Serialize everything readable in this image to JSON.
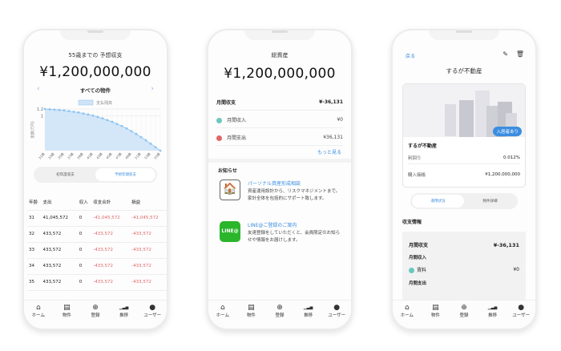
{
  "screen1": {
    "title": "55歳までの 予想収支",
    "amount": "¥1,200,000,000",
    "property": "すべての物件",
    "toggle": [
      "初年度収支",
      "予想年間収支"
    ],
    "table": {
      "headers": [
        "年齢",
        "支出",
        "収入",
        "収支合計",
        "損益"
      ],
      "rows": [
        [
          "31",
          "41,045,572",
          "0",
          "-41,045,572",
          "-41,045,572"
        ],
        [
          "32",
          "433,572",
          "0",
          "-433,572",
          "-433,572"
        ],
        [
          "33",
          "433,572",
          "0",
          "-433,572",
          "-433,572"
        ],
        [
          "34",
          "433,572",
          "0",
          "-433,572",
          "-433,572"
        ],
        [
          "35",
          "433,572",
          "0",
          "-433,572",
          "-433,572"
        ]
      ]
    }
  },
  "chart_data": {
    "type": "area",
    "legend": "支払残高",
    "ylabel": "金額(万円)",
    "ylim": [
      0,
      1.2
    ],
    "yticks": [
      "1.2",
      "1"
    ],
    "x": [
      31,
      32,
      33,
      34,
      35,
      36,
      37,
      38,
      39,
      40,
      41,
      42,
      43,
      44,
      45,
      46,
      47,
      48,
      49,
      50,
      51,
      52,
      53,
      54,
      55
    ],
    "xticks": [
      "31歳",
      "33歳",
      "35歳",
      "37歳",
      "39歳",
      "41歳",
      "43歳",
      "45歳",
      "47歳",
      "49歳",
      "51歳",
      "53歳",
      "55歳"
    ],
    "values": [
      1.2,
      1.19,
      1.18,
      1.17,
      1.16,
      1.14,
      1.12,
      1.1,
      1.07,
      1.04,
      1.01,
      0.97,
      0.93,
      0.88,
      0.83,
      0.77,
      0.71,
      0.64,
      0.56,
      0.48,
      0.39,
      0.3,
      0.2,
      0.1,
      0.0
    ],
    "color": "#8cc4f0"
  },
  "screen2": {
    "title": "総資産",
    "amount": "¥1,200,000,000",
    "monthly_label": "月間収支",
    "monthly_value": "¥-36,131",
    "income_label": "月間収入",
    "income_value": "¥0",
    "expense_label": "月間支出",
    "expense_value": "¥36,131",
    "more": "もっと見る",
    "news_title": "お知らせ",
    "news": [
      {
        "title": "パーソナル資産形成相談",
        "body": "資産運用設計から、リスクマネジメントまで。家計全体を包括的にサポート致します。"
      },
      {
        "title": "LINE@ご登録のご案内",
        "body": "友達登録をしていただくと、会員限定のお知らせや情報をお届けします。",
        "logo": "LINE@"
      }
    ]
  },
  "screen3": {
    "back": "戻る",
    "title": "するが不動産",
    "badge": "入居者あり",
    "name": "するが不動産",
    "yield_label": "利回り",
    "yield_value": "0.012%",
    "price_label": "購入価格",
    "price_value": "¥1,200,000,000",
    "toggle": [
      "運用状況",
      "物件詳細"
    ],
    "section": "収支情報",
    "monthly_label": "月間収支",
    "monthly_value": "¥-36,131",
    "income_label": "月間収入",
    "rent_label": "賃料",
    "rent_value": "¥0",
    "expense_label": "月間支出"
  },
  "tabs": [
    "ホーム",
    "物件",
    "登録",
    "推移",
    "ユーザー"
  ],
  "colors": {
    "accent": "#3a8de0",
    "income": "#6cc7c0",
    "expense": "#e06666",
    "line": "#2bb52b"
  }
}
